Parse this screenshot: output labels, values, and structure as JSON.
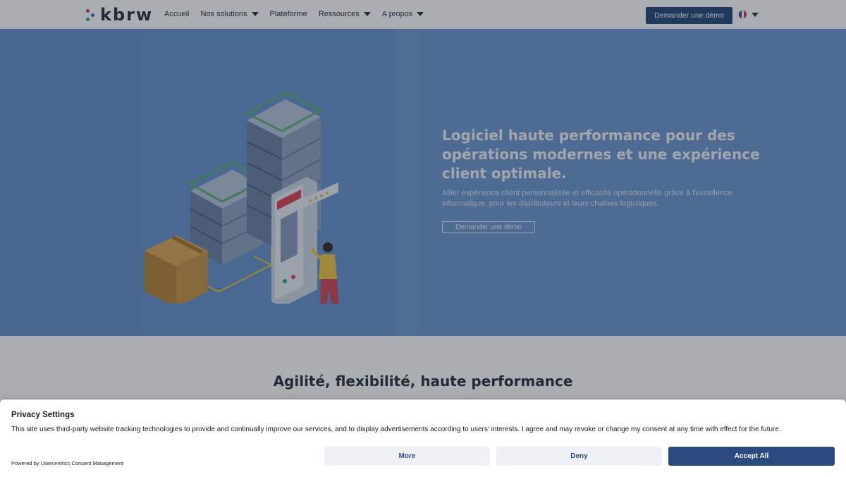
{
  "header": {
    "logo_text": "kbrw",
    "nav": [
      {
        "label": "Accueil",
        "has_dropdown": false
      },
      {
        "label": "Nos solutions",
        "has_dropdown": true
      },
      {
        "label": "Plateforme",
        "has_dropdown": false
      },
      {
        "label": "Ressources",
        "has_dropdown": true
      },
      {
        "label": "A propos",
        "has_dropdown": true
      }
    ],
    "demo_button": "Demander une démo",
    "language_icon": "france-flag-icon"
  },
  "hero": {
    "title": "Logiciel haute performance pour des opérations modernes et une expérience client optimale.",
    "subtitle": "Allier expérience client personnalisée et efficacité opérationnelle grâce à l'excellence informatique, pour les distributeurs et leurs chaînes logistiques.",
    "cta": "Demander une démo",
    "illustration_icon": "servers-and-phone-illustration"
  },
  "section": {
    "title": "Agilité, flexibilité, haute performance"
  },
  "consent": {
    "title": "Privacy Settings",
    "text": "This site uses third-party website tracking technologies to provide and continually improve our services, and to display advertisements according to users' interests. I agree and may revoke or change my consent at any time with effect for the future.",
    "powered_by": "Powered by Usercentrics Consent Management",
    "buttons": {
      "more": "More",
      "deny": "Deny",
      "accept": "Accept All"
    }
  },
  "colors": {
    "brand_dark": "#2b4a7e",
    "hero_bg": "#6a95cf",
    "text_dark": "#2d3445",
    "logo_dot_red": "#e0384b",
    "logo_dot_blue": "#3b6bd8",
    "logo_dot_green": "#3aa374"
  }
}
